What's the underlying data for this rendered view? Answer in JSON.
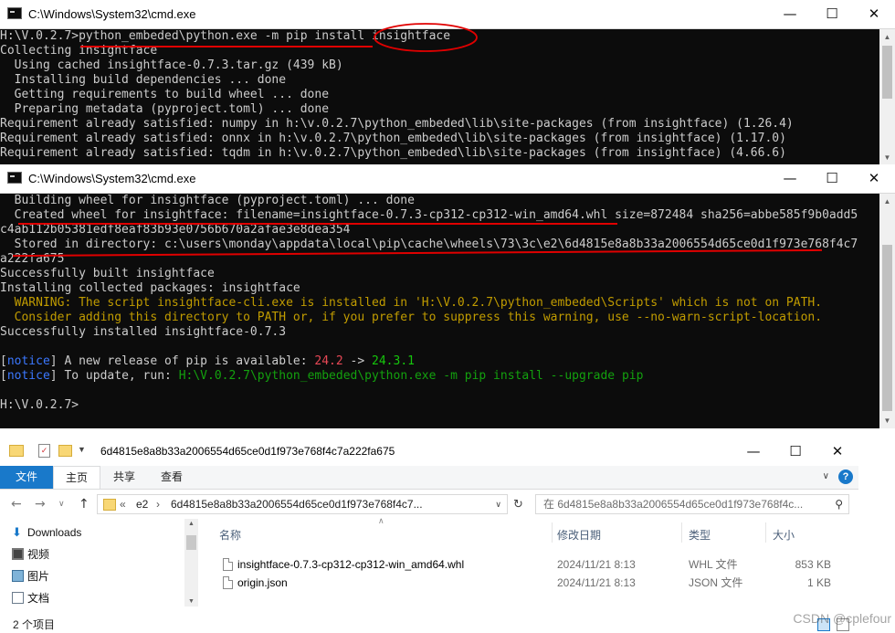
{
  "cmd1": {
    "title": "C:\\Windows\\System32\\cmd.exe",
    "lines": [
      [
        {
          "t": "H:\\V.0.2.7>python_embeded\\python.exe -m pip install insightface",
          "c": ""
        }
      ],
      [
        {
          "t": "Collecting insightface",
          "c": ""
        }
      ],
      [
        {
          "t": "  Using cached insightface-0.7.3.tar.gz (439 kB)",
          "c": ""
        }
      ],
      [
        {
          "t": "  Installing build dependencies ... done",
          "c": ""
        }
      ],
      [
        {
          "t": "  Getting requirements to build wheel ... done",
          "c": ""
        }
      ],
      [
        {
          "t": "  Preparing metadata (pyproject.toml) ... done",
          "c": ""
        }
      ],
      [
        {
          "t": "Requirement already satisfied: numpy in h:\\v.0.2.7\\python_embeded\\lib\\site-packages (from insightface) (1.26.4)",
          "c": ""
        }
      ],
      [
        {
          "t": "Requirement already satisfied: onnx in h:\\v.0.2.7\\python_embeded\\lib\\site-packages (from insightface) (1.17.0)",
          "c": ""
        }
      ],
      [
        {
          "t": "Requirement already satisfied: tqdm in h:\\v.0.2.7\\python_embeded\\lib\\site-packages (from insightface) (4.66.6)",
          "c": ""
        }
      ]
    ]
  },
  "cmd2": {
    "title": "C:\\Windows\\System32\\cmd.exe",
    "lines": [
      [
        {
          "t": "  Building wheel for insightface (pyproject.toml) ... done",
          "c": ""
        }
      ],
      [
        {
          "t": "  Created wheel for insightface: filename=insightface-0.7.3-cp312-cp312-win_amd64.whl size=872484 sha256=abbe585f9b0add5",
          "c": ""
        }
      ],
      [
        {
          "t": "c4ab112b05381edf8eaf83b93e0756b670a2afae3e8dea354",
          "c": ""
        }
      ],
      [
        {
          "t": "  Stored in directory: c:\\users\\monday\\appdata\\local\\pip\\cache\\wheels\\73\\3c\\e2\\6d4815e8a8b33a2006554d65ce0d1f973e768f4c7",
          "c": ""
        }
      ],
      [
        {
          "t": "a222fa675",
          "c": ""
        }
      ],
      [
        {
          "t": "Successfully built insightface",
          "c": ""
        }
      ],
      [
        {
          "t": "Installing collected packages: insightface",
          "c": ""
        }
      ],
      [
        {
          "t": "  WARNING: The script insightface-cli.exe is installed in 'H:\\V.0.2.7\\python_embeded\\Scripts' which is not on PATH.",
          "c": "y"
        }
      ],
      [
        {
          "t": "  Consider adding this directory to PATH or, if you prefer to suppress this warning, use --no-warn-script-location.",
          "c": "y"
        }
      ],
      [
        {
          "t": "Successfully installed insightface-0.7.3",
          "c": ""
        }
      ],
      [
        {
          "t": "",
          "c": ""
        }
      ],
      [
        {
          "t": "[",
          "c": ""
        },
        {
          "t": "notice",
          "c": "b"
        },
        {
          "t": "] A new release of pip is available: ",
          "c": ""
        },
        {
          "t": "24.2",
          "c": "r"
        },
        {
          "t": " -> ",
          "c": ""
        },
        {
          "t": "24.3.1",
          "c": "g"
        }
      ],
      [
        {
          "t": "[",
          "c": ""
        },
        {
          "t": "notice",
          "c": "b"
        },
        {
          "t": "] To update, run: ",
          "c": ""
        },
        {
          "t": "H:\\V.0.2.7\\python_embeded\\python.exe -m pip install --upgrade pip",
          "c": "gr"
        }
      ],
      [
        {
          "t": "",
          "c": ""
        }
      ],
      [
        {
          "t": "H:\\V.0.2.7>",
          "c": ""
        }
      ]
    ]
  },
  "explorer": {
    "title": "6d4815e8a8b33a2006554d65ce0d1f973e768f4c7a222fa675",
    "ribbon_tabs": [
      "文件",
      "主页",
      "共享",
      "查看"
    ],
    "breadcrumb": [
      "«",
      "e2",
      "›",
      "6d4815e8a8b33a2006554d65ce0d1f973e768f4c7..."
    ],
    "search_placeholder": "在 6d4815e8a8b33a2006554d65ce0d1f973e768f4c...",
    "nav_items": [
      {
        "label": "Downloads",
        "icon": "download-icon"
      },
      {
        "label": "视频",
        "icon": "video-icon"
      },
      {
        "label": "图片",
        "icon": "picture-icon"
      },
      {
        "label": "文档",
        "icon": "document-icon"
      }
    ],
    "columns": [
      "名称",
      "修改日期",
      "类型",
      "大小"
    ],
    "files": [
      {
        "name": "insightface-0.7.3-cp312-cp312-win_amd64.whl",
        "date": "2024/11/21 8:13",
        "type": "WHL 文件",
        "size": "853 KB"
      },
      {
        "name": "origin.json",
        "date": "2024/11/21 8:13",
        "type": "JSON 文件",
        "size": "1 KB"
      }
    ],
    "status": "2 个项目"
  },
  "watermark": "CSDN @cplefour",
  "colors": {
    "console_bg": "#0c0c0c",
    "console_fg": "#cccccc",
    "annotation": "#e00000",
    "ribbon_file": "#1979ca"
  }
}
